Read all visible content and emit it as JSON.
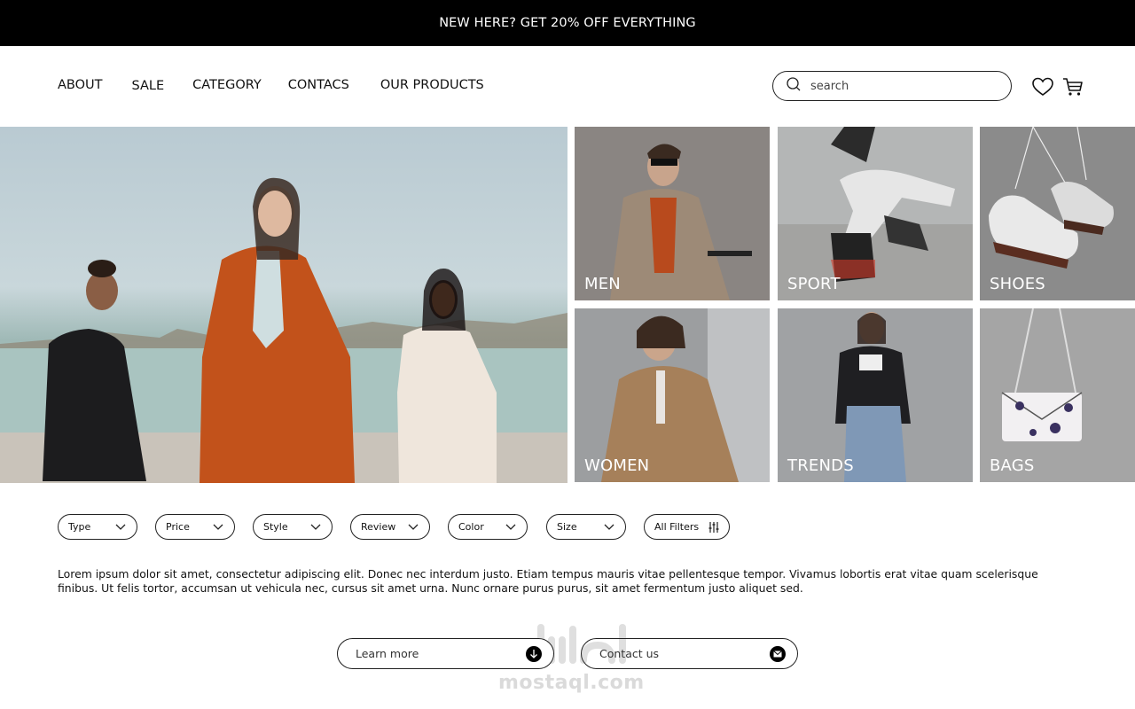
{
  "promo": {
    "text": "NEW HERE? GET 20% OFF EVERYTHING"
  },
  "nav": {
    "items": [
      {
        "label": "ABOUT"
      },
      {
        "label": "SALE"
      },
      {
        "label": "CATEGORY"
      },
      {
        "label": "CONTACS"
      },
      {
        "label": "OUR PRODUCTS"
      }
    ]
  },
  "search": {
    "placeholder": "search",
    "icon": "search-icon"
  },
  "header_icons": {
    "wishlist": "heart-icon",
    "cart": "cart-icon"
  },
  "categories": [
    {
      "label": "MEN"
    },
    {
      "label": "SPORT"
    },
    {
      "label": "SHOES"
    },
    {
      "label": "WOMEN"
    },
    {
      "label": "TRENDS"
    },
    {
      "label": "BAGS"
    }
  ],
  "filters": [
    {
      "label": "Type"
    },
    {
      "label": "Price"
    },
    {
      "label": "Style"
    },
    {
      "label": "Review"
    },
    {
      "label": "Color"
    },
    {
      "label": "Size"
    },
    {
      "label": "All Filters"
    }
  ],
  "description": "Lorem ipsum dolor sit amet, consectetur adipiscing elit. Donec nec interdum justo. Etiam tempus mauris vitae pellentesque tempor. Vivamus lobortis erat vitae quam scelerisque finibus. Ut felis tortor, accumsan ut vehicula nec, cursus sit amet urna. Nunc ornare purus purus, sit amet fermentum justo aliquet sed.",
  "cta": {
    "learn_more": "Learn more",
    "contact_us": "Contact us"
  },
  "watermark": {
    "text": "mostaql.com"
  },
  "colors": {
    "promo_bg": "#000000",
    "text": "#111111",
    "border": "#222222",
    "background": "#ffffff"
  }
}
